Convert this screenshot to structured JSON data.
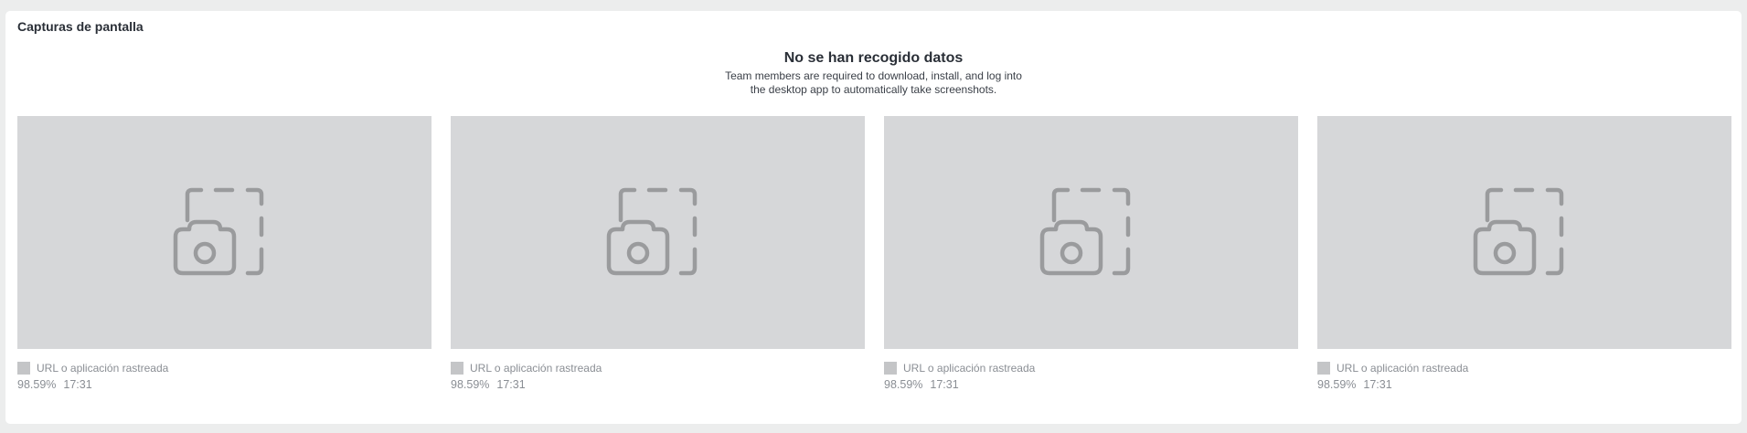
{
  "section": {
    "title": "Capturas de pantalla"
  },
  "empty_state": {
    "title": "No se han recogido datos",
    "description": "Team members are required to download, install, and log into the desktop app to automatically take screenshots."
  },
  "icons": {
    "placeholder": "camera-screenshot-icon",
    "app": "app-placeholder-icon"
  },
  "colors": {
    "thumbnail_bg": "#d6d7d9",
    "icon": "#9a9b9d",
    "muted_text": "#8a8e94"
  },
  "screenshots": [
    {
      "app_label": "URL o aplicación rastreada",
      "activity": "98.59%",
      "time": "17:31"
    },
    {
      "app_label": "URL o aplicación rastreada",
      "activity": "98.59%",
      "time": "17:31"
    },
    {
      "app_label": "URL o aplicación rastreada",
      "activity": "98.59%",
      "time": "17:31"
    },
    {
      "app_label": "URL o aplicación rastreada",
      "activity": "98.59%",
      "time": "17:31"
    }
  ]
}
